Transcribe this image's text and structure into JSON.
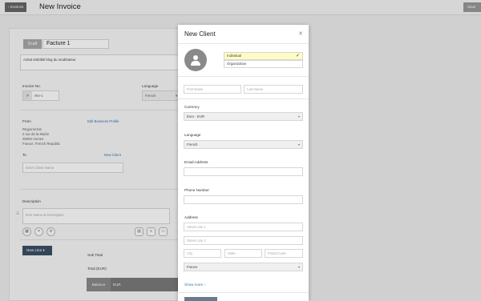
{
  "header": {
    "back_label": "‹ Invoices",
    "title": "New Invoice",
    "send_label": "Save"
  },
  "invoice": {
    "status_badge": "Draft",
    "name": "Facture 1",
    "description": "Achat visibilité blog du modérateur",
    "invoice_no_label": "Invoice No.",
    "invoice_no_prefix": "#",
    "invoice_no_value": "INV-1",
    "language_label": "Language",
    "language_value": "French",
    "from_label": "From",
    "edit_profile_link": "Edit Business Profile",
    "from_address": [
      "Regions/Job",
      "2 rue de la Mairie",
      "35000 rennes",
      "France, French Republic"
    ],
    "to_label": "To",
    "new_client_link": "New Client",
    "client_placeholder": "Enter Client Name",
    "description_label": "Description",
    "item_placeholder": "Item Name & Description",
    "new_line_label": "New Line ▾",
    "subtotal_label": "Sub Total",
    "total_label": "Total (EUR)",
    "balance_label": "Balance",
    "balance_currency": "EUR"
  },
  "modal": {
    "title": "New Client",
    "close_icon": "close-icon",
    "types": [
      {
        "label": "Individual",
        "selected": true
      },
      {
        "label": "Organization",
        "selected": false
      }
    ],
    "first_name_placeholder": "First Name",
    "last_name_placeholder": "Last Name",
    "currency_label": "Currency",
    "currency_value": "Euro - EUR",
    "language_label": "Language",
    "language_value": "French",
    "email_label": "Email Address",
    "phone_label": "Phone Number",
    "address_label": "Address",
    "street1_placeholder": "Street Line 1",
    "street2_placeholder": "Street Line 2",
    "city_placeholder": "City",
    "state_placeholder": "State",
    "postal_placeholder": "Postal Code",
    "country_value": "France",
    "show_more": "Show more ›"
  },
  "colors": {
    "accent": "#3a76b5",
    "selected_type_bg": "#fefcc4",
    "new_line_btn": "#3d4f66"
  }
}
